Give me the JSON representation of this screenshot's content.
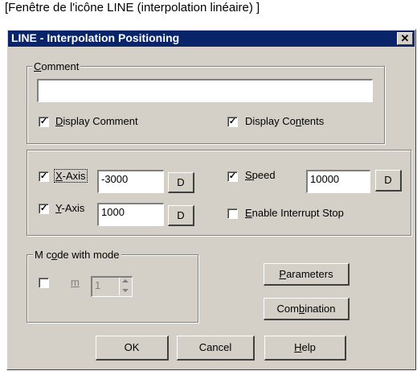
{
  "caption": "[Fenêtre de l'icône LINE (interpolation linéaire) ]",
  "window": {
    "title": "LINE - Interpolation Positioning",
    "close_glyph": "✕"
  },
  "comment_group": {
    "legend": "Comment",
    "value": "",
    "display_comment": {
      "label": "Display Comment",
      "checked": true
    },
    "display_contents": {
      "label": "Display Contents",
      "checked": true
    }
  },
  "axis_group": {
    "x_axis": {
      "label": "X-Axis",
      "checked": true,
      "value": "-3000",
      "button": "D"
    },
    "y_axis": {
      "label": "Y-Axis",
      "checked": true,
      "value": "1000",
      "button": "D"
    },
    "speed": {
      "label": "Speed",
      "checked": true,
      "value": "10000",
      "button": "D"
    },
    "interrupt_stop": {
      "label": "Enable Interrupt Stop",
      "checked": false
    }
  },
  "mcode_group": {
    "legend": "M code with mode",
    "m": {
      "label": "m",
      "checked": false,
      "value": "1"
    }
  },
  "buttons": {
    "parameters": "Parameters",
    "combination": "Combination",
    "ok": "OK",
    "cancel": "Cancel",
    "help": "Help"
  },
  "icons": {
    "check": "check-mark",
    "spin_up": "spin-up-arrow",
    "spin_down": "spin-down-arrow",
    "close": "close-x"
  },
  "colors": {
    "titlebar": "#0a246a",
    "dialog_face": "#d4d0c8"
  }
}
